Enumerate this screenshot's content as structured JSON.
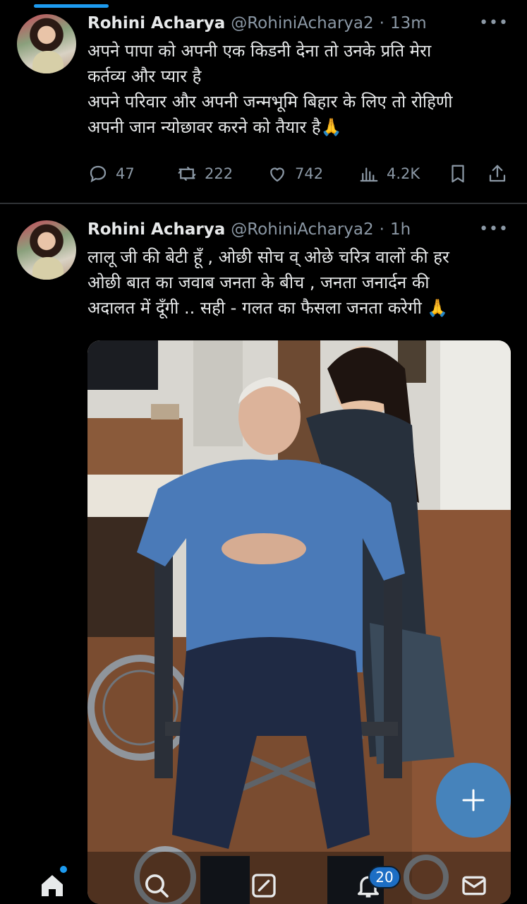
{
  "tweets": [
    {
      "author_name": "Rohini Acharya",
      "handle": "@RohiniAcharya2",
      "separator": "·",
      "time": "13m",
      "text": "अपने पापा को अपनी एक किडनी देना तो उनके प्रति मेरा\nकर्तव्य और प्यार है\nअपने परिवार और अपनी जन्मभूमि बिहार के लिए तो रोहिणी\nअपनी जान न्योछावर करने को तैयार है🙏",
      "replies": "47",
      "retweets": "222",
      "likes": "742",
      "views": "4.2K"
    },
    {
      "author_name": "Rohini Acharya",
      "handle": "@RohiniAcharya2",
      "separator": "·",
      "time": "1h",
      "text": "लालू जी की बेटी हूँ , ओछी सोच व् ओछे चरित्र वालों की हर\nओछी बात का जवाब जनता के बीच , जनता जनार्दन की\nअदालत में दूँगी .. सही - गलत का फैसला जनता करेगी 🙏"
    }
  ],
  "more_label": "•••",
  "fab_label": "+",
  "nav": {
    "notifications_badge": "20"
  },
  "colors": {
    "accent": "#1d9bf0",
    "background": "#000000",
    "text": "#e7e9ea",
    "muted": "#8b98a5"
  },
  "icons": [
    "reply-icon",
    "retweet-icon",
    "like-icon",
    "views-icon",
    "bookmark-icon",
    "share-icon",
    "home-icon",
    "search-icon",
    "communities-icon",
    "notifications-icon",
    "messages-icon",
    "compose-icon"
  ]
}
